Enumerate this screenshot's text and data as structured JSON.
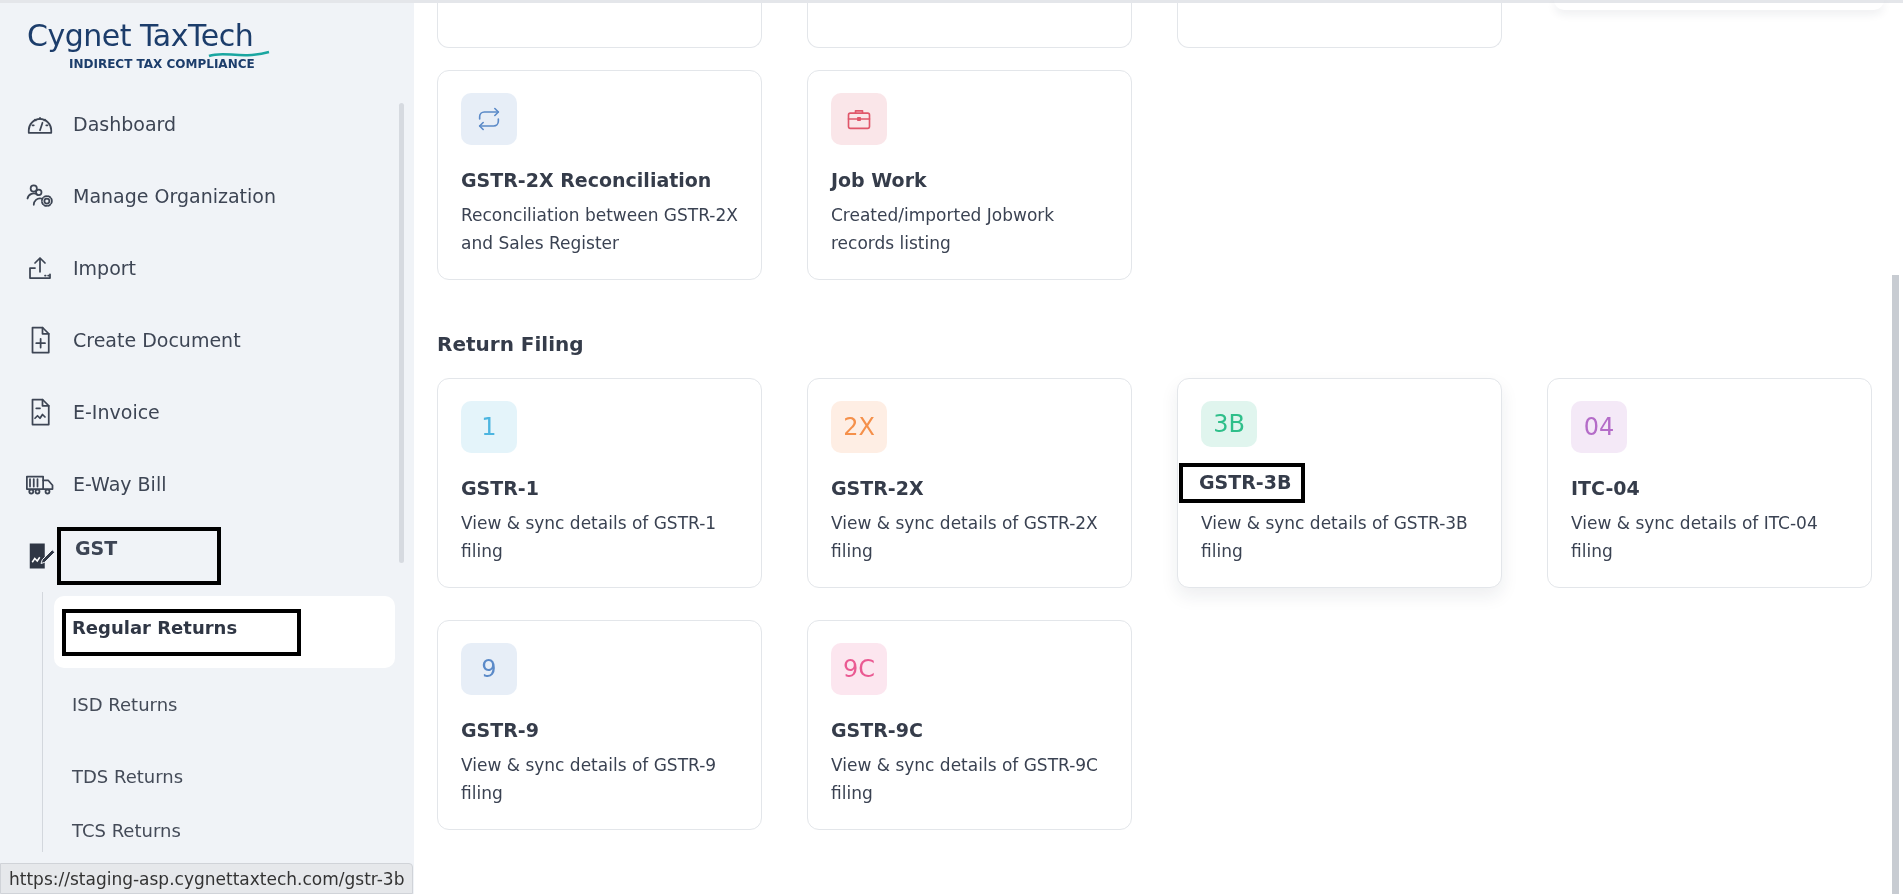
{
  "logo": {
    "name": "Cygnet TaxTech",
    "tagline": "INDIRECT TAX COMPLIANCE"
  },
  "nav": [
    {
      "label": "Dashboard",
      "kind": "gauge",
      "selected": false,
      "annotated": false
    },
    {
      "label": "Manage Organization",
      "kind": "org",
      "selected": false,
      "annotated": false
    },
    {
      "label": "Import",
      "kind": "upload",
      "selected": false,
      "annotated": false
    },
    {
      "label": "Create Document",
      "kind": "doc",
      "selected": false,
      "annotated": false
    },
    {
      "label": "E-Invoice",
      "kind": "invoice",
      "selected": false,
      "annotated": false
    },
    {
      "label": "E-Way Bill",
      "kind": "truck",
      "selected": false,
      "annotated": false
    },
    {
      "label": "GST",
      "kind": "gst",
      "selected": true,
      "annotated": true,
      "children": [
        {
          "label": "Regular Returns",
          "selected": true,
          "annotated": true
        },
        {
          "label": "ISD Returns",
          "selected": false,
          "annotated": false
        },
        {
          "label": "TDS Returns",
          "selected": false,
          "annotated": false
        },
        {
          "label": "TCS Returns",
          "selected": false,
          "annotated": false
        }
      ]
    }
  ],
  "status_bar": {
    "url": "https://staging-asp.cygnettaxtech.com/gstr-3b"
  },
  "top_cards": [
    {
      "kind": "cut"
    },
    {
      "kind": "cut"
    },
    {
      "kind": "cut"
    }
  ],
  "tool_cards": [
    {
      "kind": "arrows",
      "title": "GSTR-2X Reconciliation",
      "description": "Reconciliation between GSTR-2X and Sales Register",
      "color": "#5b8ac8"
    },
    {
      "kind": "briefcase",
      "title": "Job Work",
      "description": "Created/imported Jobwork records listing",
      "color": "#e0566a"
    }
  ],
  "return_filing": {
    "heading": "Return Filing",
    "cards": [
      {
        "badge": "1",
        "title": "GSTR-1",
        "description": "View & sync details of GSTR-1 filing",
        "color": "#4cb5e0",
        "annotated": false
      },
      {
        "badge": "2X",
        "title": "GSTR-2X",
        "description": "View & sync details of GSTR-2X filing",
        "color": "#f5904a",
        "annotated": false
      },
      {
        "badge": "3B",
        "title": "GSTR-3B",
        "description": "View & sync details of GSTR-3B filing",
        "color": "#2fbf8a",
        "annotated": true
      },
      {
        "badge": "04",
        "title": "ITC-04",
        "description": "View & sync details of ITC-04 filing",
        "color": "#b46cc8",
        "annotated": false
      },
      {
        "badge": "9",
        "title": "GSTR-9",
        "description": "View & sync details of GSTR-9 filing",
        "color": "#5b8ac8",
        "annotated": false
      },
      {
        "badge": "9C",
        "title": "GSTR-9C",
        "description": "View & sync details of GSTR-9C filing",
        "color": "#ea5a92",
        "annotated": false
      }
    ]
  }
}
